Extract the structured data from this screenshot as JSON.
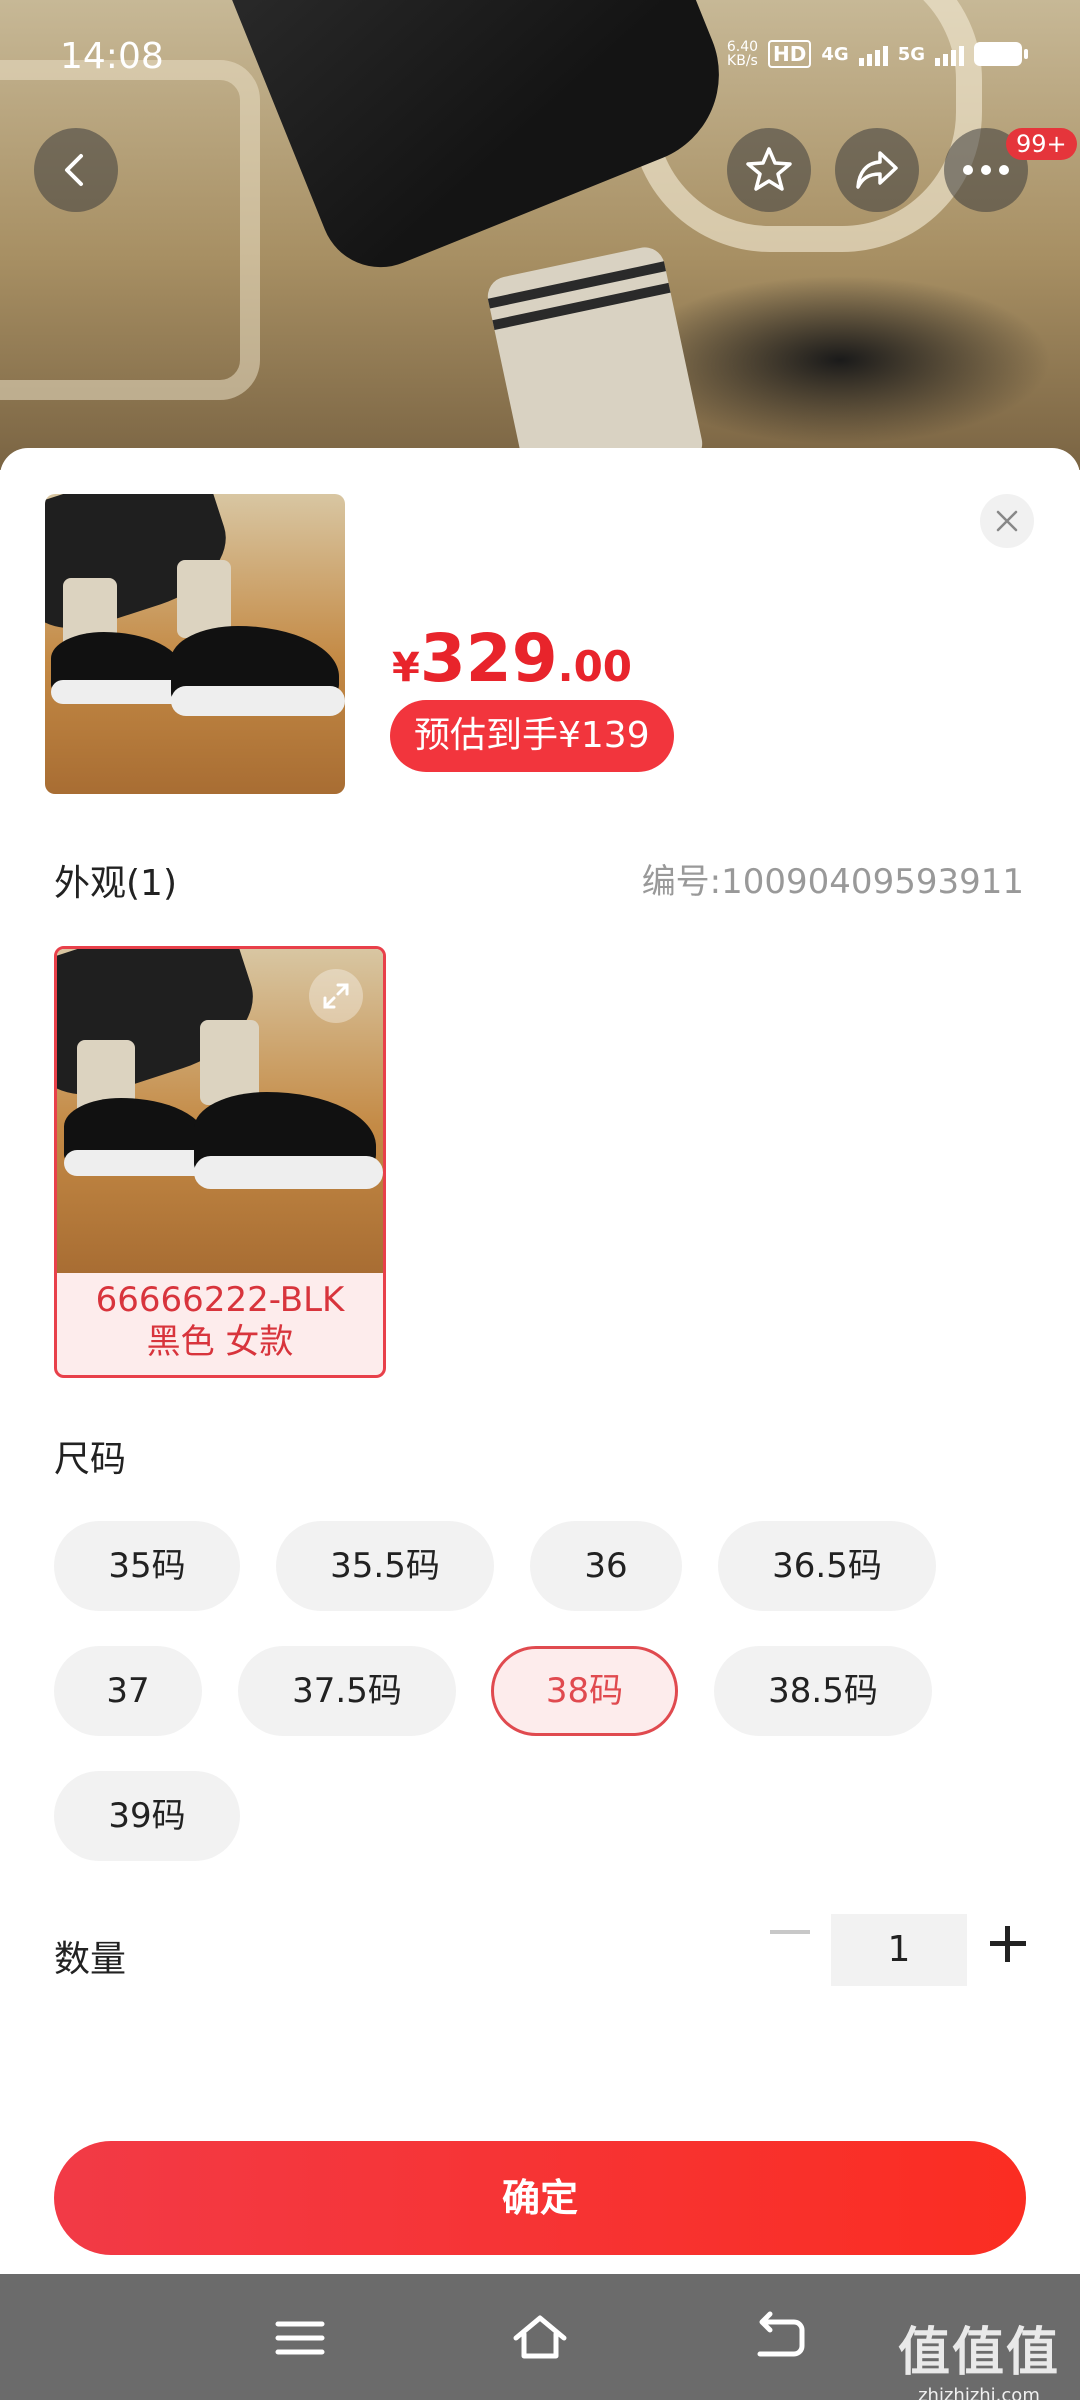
{
  "status_bar": {
    "time": "14:08",
    "net_speed_value": "6.40",
    "net_speed_unit": "KB/s",
    "hd_label": "HD",
    "network_1": "4G",
    "network_2": "5G"
  },
  "header": {
    "badge": "99+"
  },
  "product": {
    "currency": "¥",
    "price_integer": "329",
    "price_decimal": ".00",
    "estimated_price": "预估到手¥139"
  },
  "appearance": {
    "title": "外观(1)",
    "sku_number": "编号:10090409593911",
    "variant": {
      "code": "66666222-BLK",
      "desc": "黑色 女款",
      "selected": true
    }
  },
  "size": {
    "title": "尺码",
    "options": [
      "35码",
      "35.5码",
      "36",
      "36.5码",
      "37",
      "37.5码",
      "38码",
      "38.5码",
      "39码"
    ],
    "selected": "38码"
  },
  "quantity": {
    "title": "数量",
    "value": "1"
  },
  "confirm_label": "确定",
  "watermark": {
    "logo_text": "值值值",
    "domain": "zhizhizhi.com"
  },
  "colors": {
    "accent": "#f2353d",
    "price_red": "#e8242b",
    "chip_bg": "#f2f2f2",
    "navbar_bg": "#6b6b6b"
  }
}
